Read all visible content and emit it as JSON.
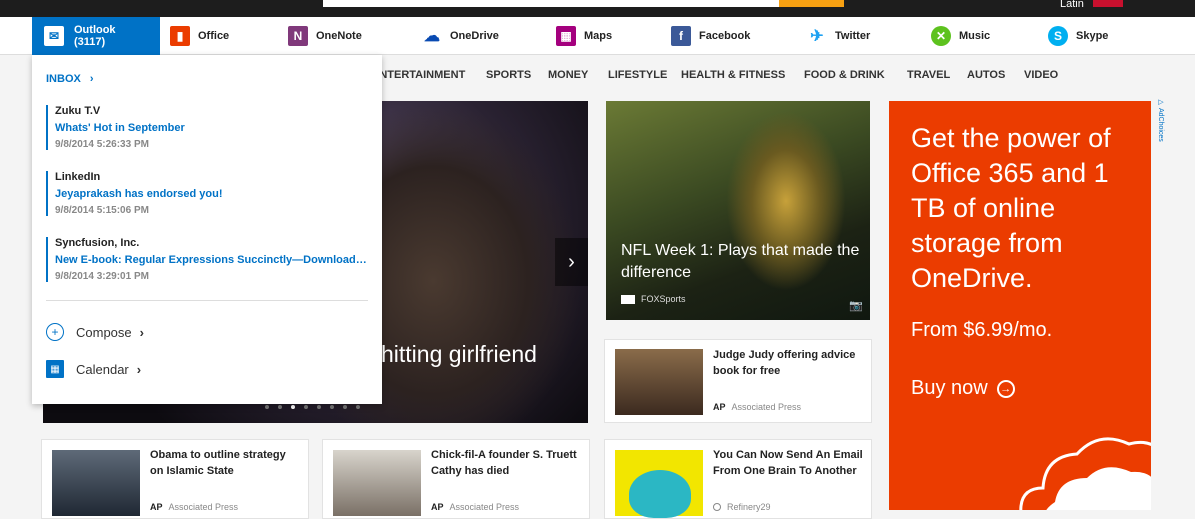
{
  "topbar": {
    "language": "Latin"
  },
  "apps": [
    {
      "label": "Outlook (3117)",
      "icon": "outlook-icon",
      "color": "#0072c6"
    },
    {
      "label": "Office",
      "icon": "office-icon",
      "color": "#eb3c00"
    },
    {
      "label": "OneNote",
      "icon": "onenote-icon",
      "color": "#80397b"
    },
    {
      "label": "OneDrive",
      "icon": "onedrive-icon",
      "color": "#094ab2"
    },
    {
      "label": "Maps",
      "icon": "maps-icon",
      "color": "#a4007e"
    },
    {
      "label": "Facebook",
      "icon": "facebook-icon",
      "color": "#3b5998"
    },
    {
      "label": "Twitter",
      "icon": "twitter-icon",
      "color": "#1da1f2"
    },
    {
      "label": "Music",
      "icon": "xbox-music-icon",
      "color": "#5dc21e"
    },
    {
      "label": "Skype",
      "icon": "skype-icon",
      "color": "#00aff0"
    }
  ],
  "nav": [
    "ENTERTAINMENT",
    "SPORTS",
    "MONEY",
    "LIFESTYLE",
    "HEALTH & FITNESS",
    "FOOD & DRINK",
    "TRAVEL",
    "AUTOS",
    "VIDEO"
  ],
  "outlook_panel": {
    "inbox_label": "INBOX",
    "messages": [
      {
        "from": "Zuku T.V",
        "subject": "Whats' Hot in September",
        "date": "9/8/2014 5:26:33 PM"
      },
      {
        "from": "LinkedIn",
        "subject": "Jeyaprakash has endorsed you!",
        "date": "9/8/2014 5:15:06 PM"
      },
      {
        "from": "Syncfusion, Inc.",
        "subject": "New E-book: Regular Expressions Succinctly—Download N...",
        "date": "9/8/2014 3:29:01 PM"
      }
    ],
    "compose_label": "Compose",
    "calendar_label": "Calendar"
  },
  "hero": {
    "headline": "hitting girlfriend",
    "slide_count": 8,
    "active_slide": 3
  },
  "featured": {
    "title": "NFL Week 1: Plays that made the difference",
    "source": "FOXSports"
  },
  "cards": [
    {
      "title": "Judge Judy offering advice book for free",
      "source": "Associated Press",
      "source_logo": "AP"
    },
    {
      "title": "Obama to outline strategy on Islamic State",
      "source": "Associated Press",
      "source_logo": "AP"
    },
    {
      "title": "Chick-fil-A founder S. Truett Cathy has died",
      "source": "Associated Press",
      "source_logo": "AP"
    },
    {
      "title": "You Can Now Send An Email From One Brain To Another",
      "source": "Refinery29",
      "source_logo": ""
    }
  ],
  "ad": {
    "headline": "Get the power of Office 365 and 1 TB of online storage from OneDrive.",
    "price": "From $6.99/mo.",
    "cta": "Buy now",
    "adchoices": "AdChoices",
    "background": "#eb3c00"
  }
}
